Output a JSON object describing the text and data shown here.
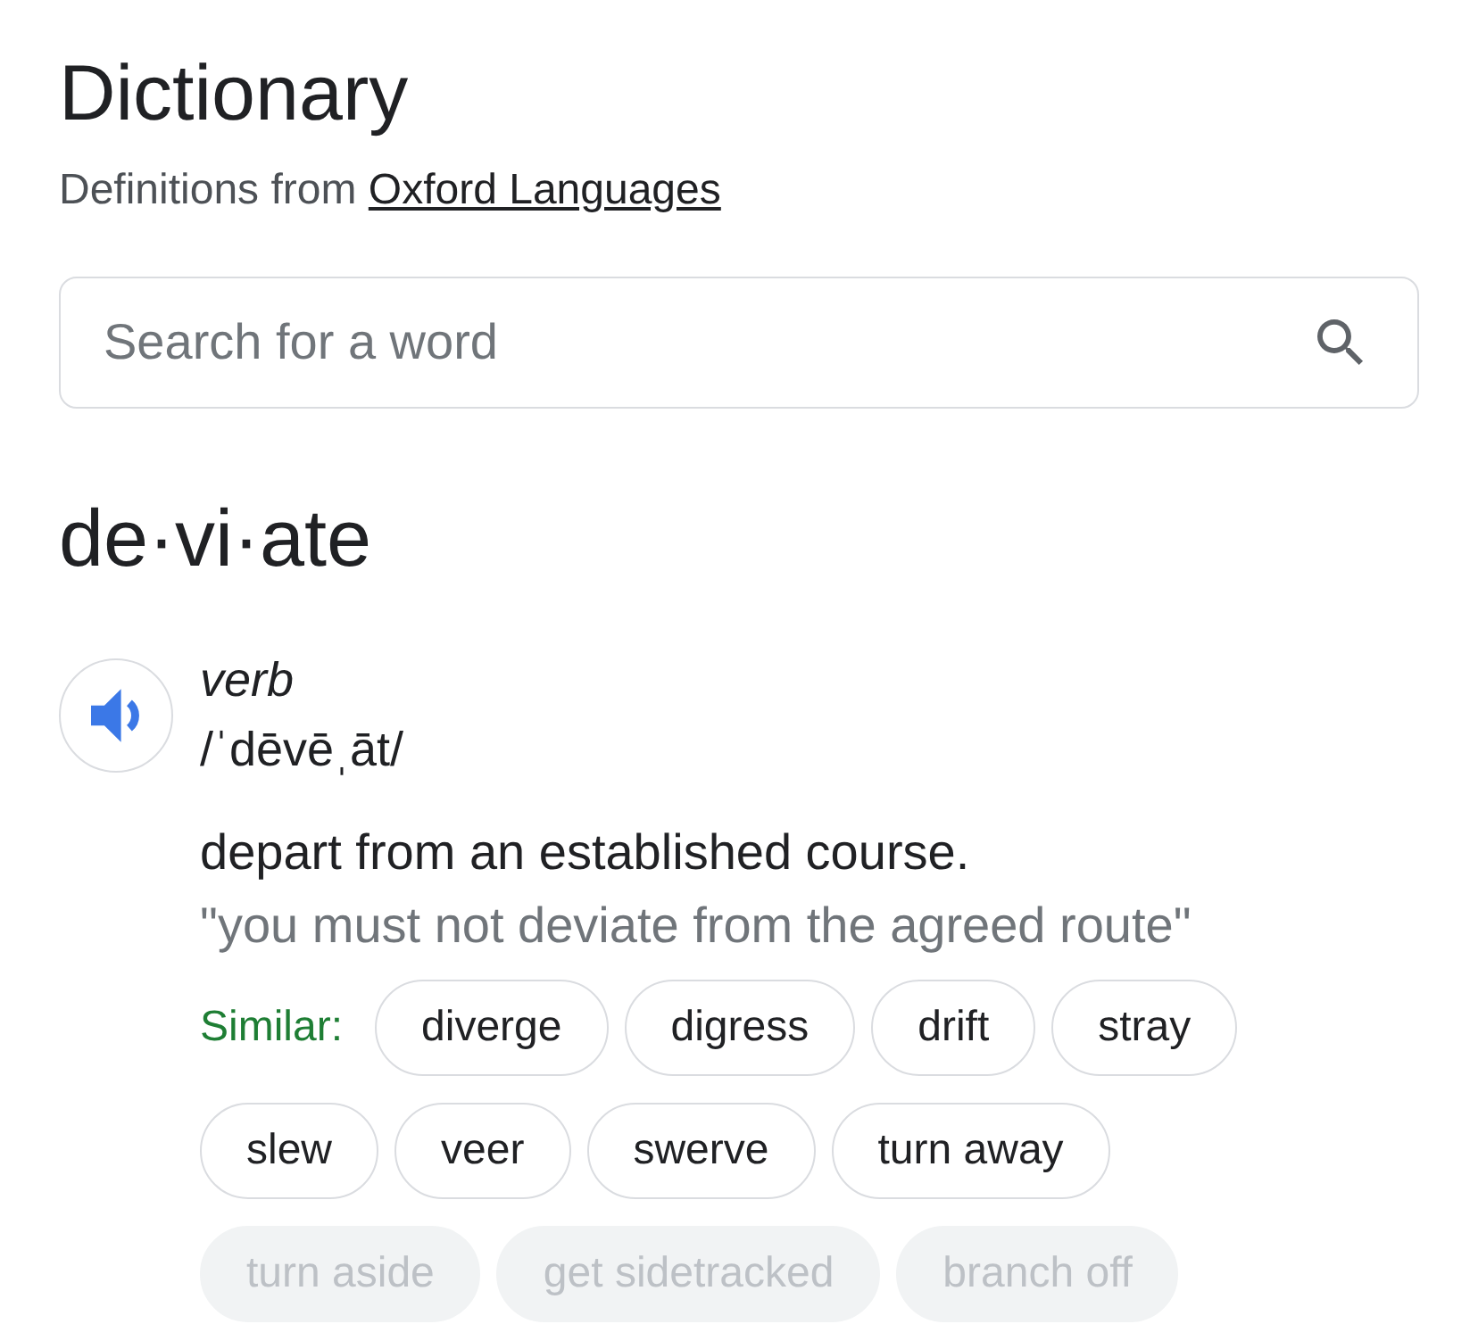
{
  "header": {
    "title": "Dictionary",
    "source_prefix": "Definitions from",
    "source_link": "Oxford Languages"
  },
  "search": {
    "placeholder": "Search for a word"
  },
  "entry": {
    "headword": "de·vi·ate",
    "part_of_speech": "verb",
    "pronunciation": "/ˈdēvēˌāt/",
    "definition": "depart from an established course.",
    "example": "\"you must not deviate from the agreed route\"",
    "similar_label": "Similar:",
    "similar": [
      {
        "label": "diverge",
        "faded": false
      },
      {
        "label": "digress",
        "faded": false
      },
      {
        "label": "drift",
        "faded": false
      },
      {
        "label": "stray",
        "faded": false
      },
      {
        "label": "slew",
        "faded": false
      },
      {
        "label": "veer",
        "faded": false
      },
      {
        "label": "swerve",
        "faded": false
      },
      {
        "label": "turn away",
        "faded": false
      },
      {
        "label": "turn aside",
        "faded": true
      },
      {
        "label": "get sidetracked",
        "faded": true
      },
      {
        "label": "branch off",
        "faded": true
      }
    ]
  }
}
